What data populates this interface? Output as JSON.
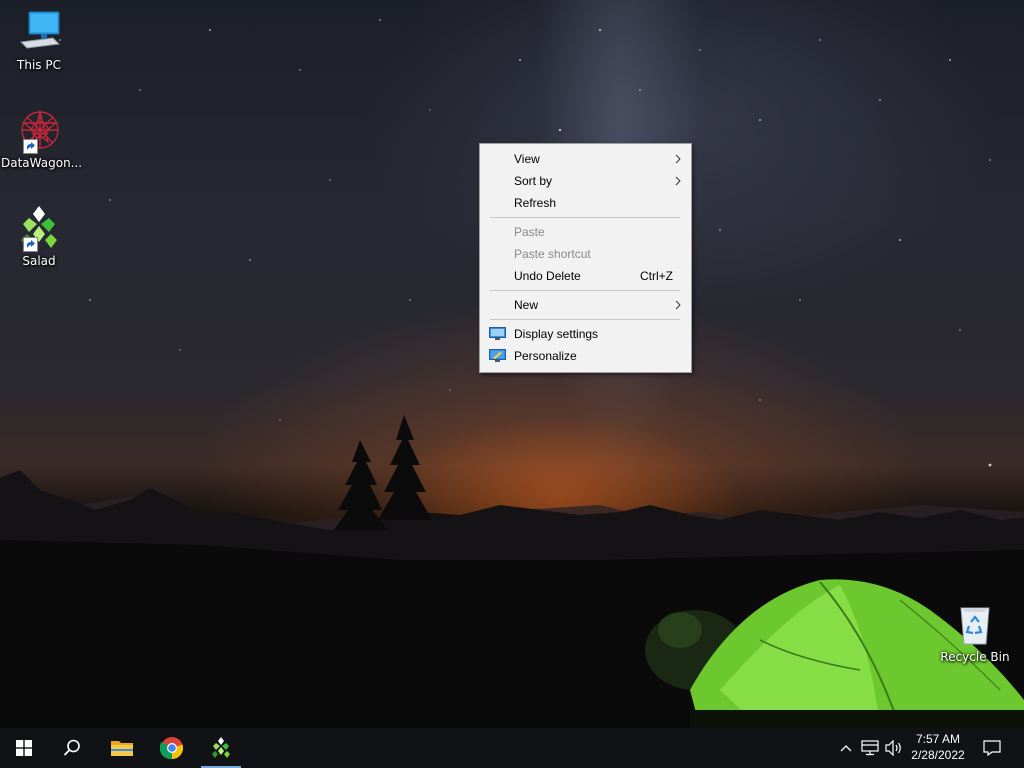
{
  "desktop": {
    "icons": [
      {
        "label": "This PC",
        "icon": "computer-icon"
      },
      {
        "label": "DataWagon...",
        "icon": "datawagon-app-icon"
      },
      {
        "label": "Salad",
        "icon": "salad-app-icon"
      },
      {
        "label": "Recycle Bin",
        "icon": "recycle-bin-icon"
      }
    ]
  },
  "context_menu": {
    "items": [
      {
        "label": "View",
        "submenu": true,
        "enabled": true
      },
      {
        "label": "Sort by",
        "submenu": true,
        "enabled": true
      },
      {
        "label": "Refresh",
        "enabled": true
      },
      {
        "label": "Paste",
        "enabled": false
      },
      {
        "label": "Paste shortcut",
        "enabled": false
      },
      {
        "label": "Undo Delete",
        "shortcut": "Ctrl+Z",
        "enabled": true
      },
      {
        "label": "New",
        "submenu": true,
        "enabled": true
      },
      {
        "label": "Display settings",
        "icon": "display-settings-icon",
        "enabled": true
      },
      {
        "label": "Personalize",
        "icon": "personalize-icon",
        "enabled": true
      }
    ]
  },
  "taskbar": {
    "buttons": [
      "windows-start-icon",
      "search-icon",
      "file-explorer-icon",
      "chrome-icon",
      "salad-taskbar-icon"
    ],
    "active_button": "salad-taskbar-icon",
    "tray": [
      "chevron-up-icon",
      "network-icon",
      "volume-icon"
    ],
    "time": "7:57 AM",
    "date": "2/28/2022",
    "notification_icon": "notification-icon"
  },
  "colors": {
    "menu_bg": "#f2f2f2",
    "taskbar_bg": "#101216",
    "tent_green": "#7ad63a",
    "sunset_orange": "#ff7a2a"
  }
}
